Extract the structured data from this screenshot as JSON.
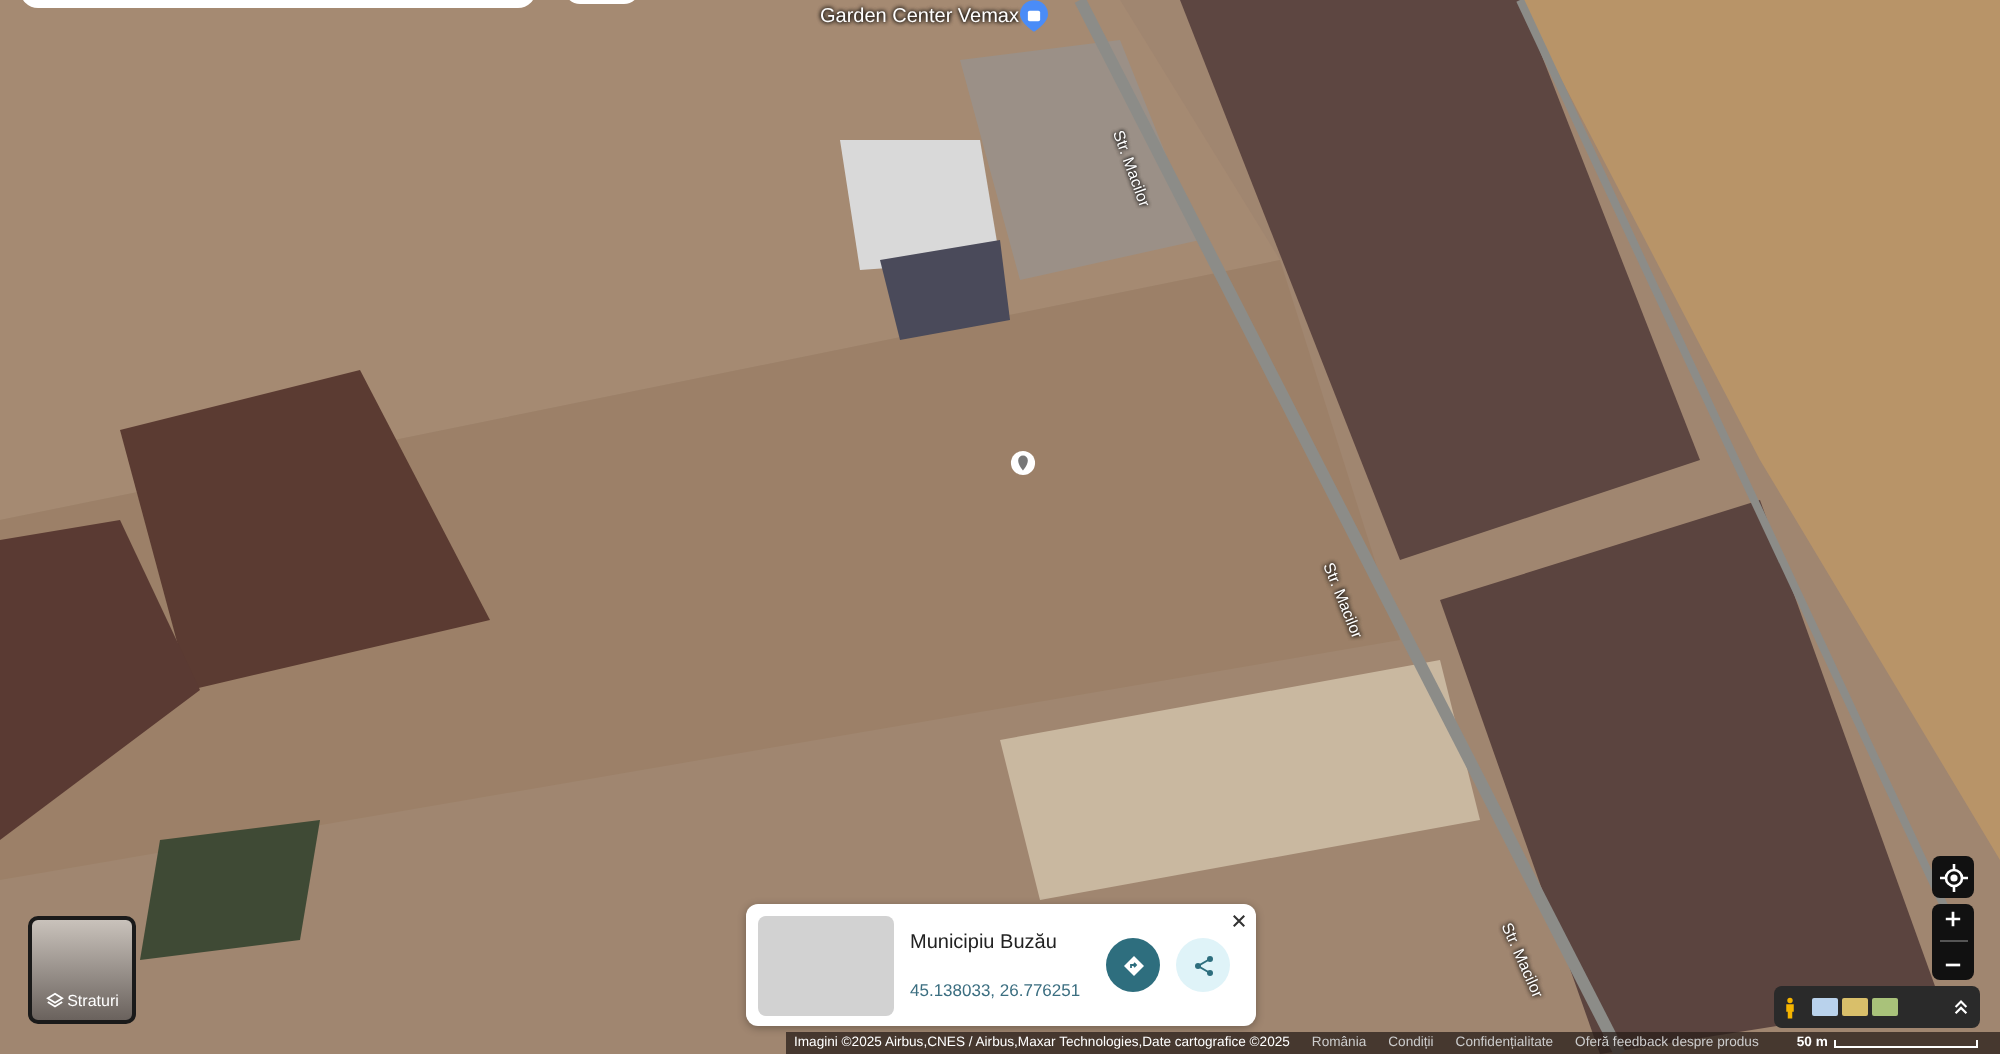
{
  "map": {
    "place_label": "Garden Center Vemax",
    "street_labels": [
      "Str. Macilor",
      "Str. Macilor",
      "Str. Macilor"
    ]
  },
  "layers_button": {
    "label": "Straturi"
  },
  "place_card": {
    "title": "Municipiu Buzău",
    "coordinates": "45.138033, 26.776251"
  },
  "footer": {
    "attribution": "Imagini ©2025 Airbus,CNES / Airbus,Maxar Technologies,Date cartografice ©2025",
    "links": [
      "România",
      "Condiții",
      "Confidențialitate",
      "Oferă feedback despre produs"
    ],
    "scale": "50 m"
  }
}
